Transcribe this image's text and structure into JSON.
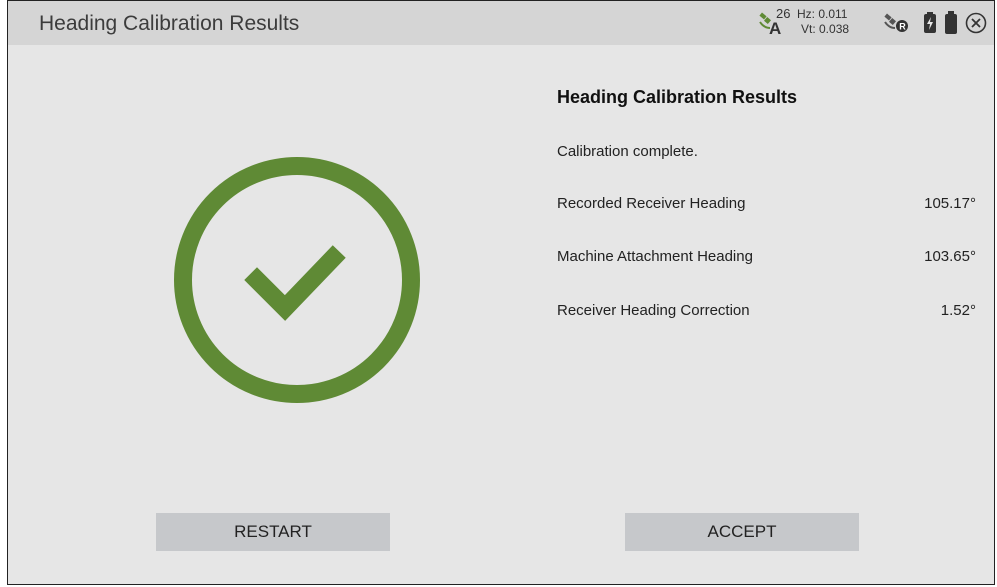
{
  "header": {
    "title": "Heading Calibration Results",
    "satellites": "26",
    "hz": "Hz: 0.011",
    "vt": "Vt: 0.038",
    "icons": [
      "gnss-satellite-icon",
      "radio-icon",
      "power-bolt-icon",
      "battery-icon",
      "close-icon"
    ]
  },
  "results": {
    "title": "Heading Calibration Results",
    "status": "Calibration complete.",
    "rows": [
      {
        "label": "Recorded Receiver Heading",
        "value": "105.17°"
      },
      {
        "label": "Machine Attachment Heading",
        "value": "103.65°"
      },
      {
        "label": "Receiver Heading Correction",
        "value": "1.52°"
      }
    ]
  },
  "buttons": {
    "restart": "RESTART",
    "accept": "ACCEPT"
  },
  "colors": {
    "success": "#5f8a35",
    "header_bg": "#d5d5d5",
    "body_bg": "#e6e6e6",
    "button_bg": "#c6c8cb"
  }
}
